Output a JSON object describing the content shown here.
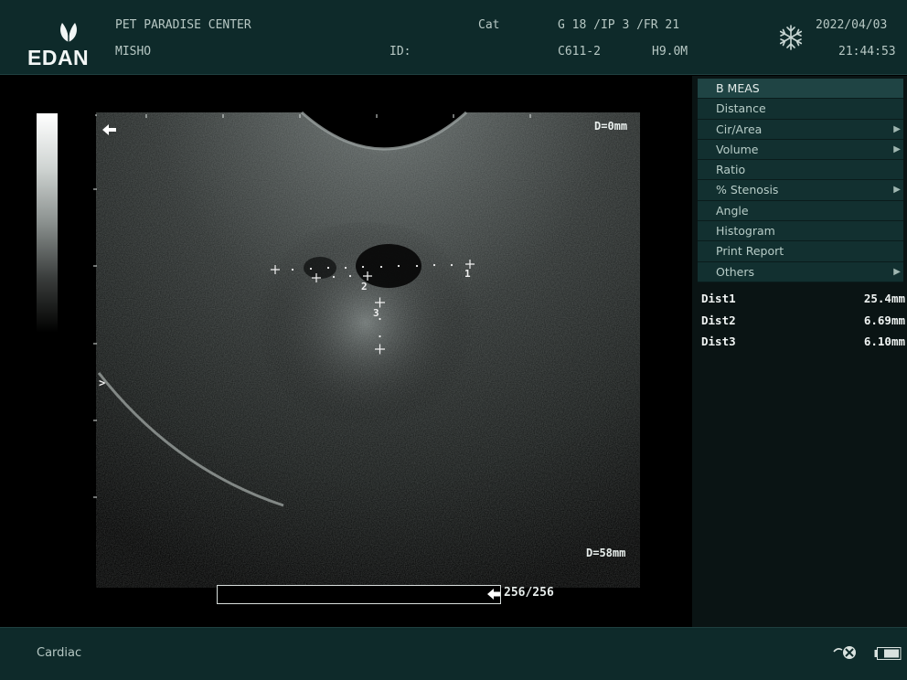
{
  "header": {
    "brand": "EDAN",
    "hospital": "PET PARADISE CENTER",
    "patient": "MISHO",
    "id_label": "ID:",
    "species": "Cat",
    "params": "G 18 /IP 3 /FR 21",
    "probe": "C611-2",
    "freq": "H9.0M",
    "date": "2022/04/03",
    "time": "21:44:53",
    "freeze_icon": "snowflake-icon"
  },
  "image": {
    "depth_top": "D=0mm",
    "depth_bottom": "D=58mm",
    "focus_marker": ">",
    "meas_labels": [
      "1",
      "2",
      "3"
    ],
    "cine_counter": "256/256",
    "cine_progress": 1.0
  },
  "menu": {
    "title": "B MEAS",
    "items": [
      {
        "label": "Distance",
        "arrow": ""
      },
      {
        "label": "Cir/Area",
        "arrow": "▶"
      },
      {
        "label": "Volume",
        "arrow": "▶"
      },
      {
        "label": "Ratio",
        "arrow": ""
      },
      {
        "label": "% Stenosis",
        "arrow": "▶"
      },
      {
        "label": "Angle",
        "arrow": ""
      },
      {
        "label": "Histogram",
        "arrow": ""
      },
      {
        "label": "Print Report",
        "arrow": ""
      },
      {
        "label": "Others",
        "arrow": "▶"
      }
    ]
  },
  "results": [
    {
      "name": "Dist1",
      "value": "25.4mm"
    },
    {
      "name": "Dist2",
      "value": "6.69mm"
    },
    {
      "name": "Dist3",
      "value": "6.10mm"
    }
  ],
  "footer": {
    "preset": "Cardiac",
    "icons": [
      "trackball-icon",
      "battery-icon"
    ]
  },
  "colors": {
    "header_bg": "#0e2a2a",
    "menu_bg": "#123030",
    "menu_header_bg": "#1f4444"
  }
}
